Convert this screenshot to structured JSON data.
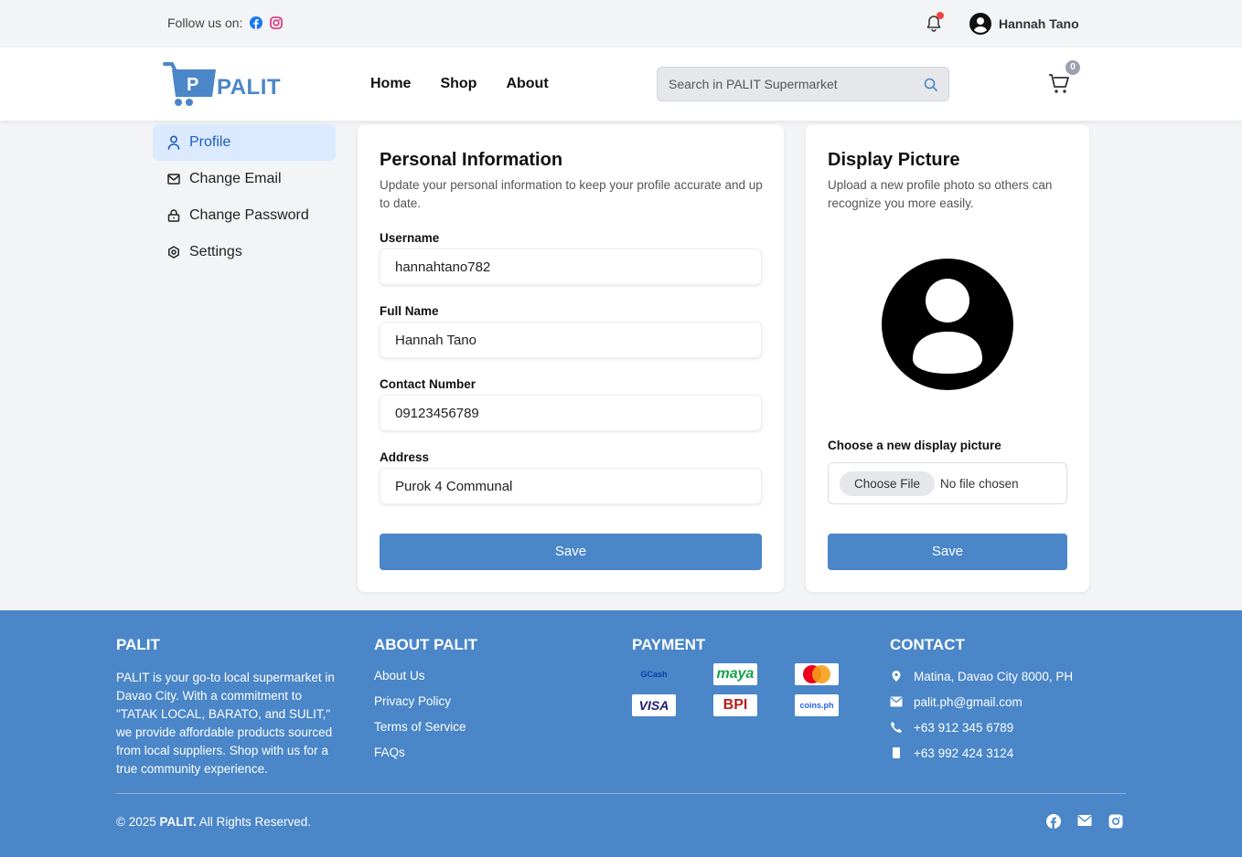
{
  "topbar": {
    "follow_label": "Follow us on:",
    "user_name": "Hannah Tano"
  },
  "header": {
    "logo_text": "PALIT",
    "logo_letter": "P",
    "nav": [
      "Home",
      "Shop",
      "About"
    ],
    "search_placeholder": "Search in PALIT Supermarket",
    "cart_count": "0"
  },
  "sidebar": {
    "items": [
      {
        "label": "Profile",
        "icon": "user-icon",
        "active": true
      },
      {
        "label": "Change Email",
        "icon": "mail-icon",
        "active": false
      },
      {
        "label": "Change Password",
        "icon": "lock-icon",
        "active": false
      },
      {
        "label": "Settings",
        "icon": "gear-icon",
        "active": false
      }
    ]
  },
  "personal": {
    "title": "Personal Information",
    "description": "Update your personal information to keep your profile accurate and up to date.",
    "fields": [
      {
        "label": "Username",
        "value": "hannahtano782"
      },
      {
        "label": "Full Name",
        "value": "Hannah Tano"
      },
      {
        "label": "Contact Number",
        "value": "09123456789"
      },
      {
        "label": "Address",
        "value": "Purok 4 Communal"
      }
    ],
    "save_label": "Save"
  },
  "picture": {
    "title": "Display Picture",
    "description": "Upload a new profile photo so others can recognize you more easily.",
    "choose_label": "Choose a new display picture",
    "file_button": "Choose File",
    "file_status": "No file chosen",
    "save_label": "Save"
  },
  "footer": {
    "palit": {
      "title": "PALIT",
      "text": "PALIT is your go-to local supermarket in Davao City. With a commitment to \"TATAK LOCAL, BARATO, and SULIT,\" we provide affordable products sourced from local suppliers. Shop with us for a true community experience."
    },
    "about": {
      "title": "ABOUT PALIT",
      "links": [
        "About Us",
        "Privacy Policy",
        "Terms of Service",
        "FAQs"
      ]
    },
    "payment": {
      "title": "PAYMENT",
      "methods": [
        "GCash",
        "maya",
        "",
        "VISA",
        "BPI",
        "coins.ph"
      ]
    },
    "contact": {
      "title": "CONTACT",
      "address": "Matina, Davao City 8000, PH",
      "email": "palit.ph@gmail.com",
      "phone": "+63 912 345 6789",
      "mobile": "+63 992 424 3124"
    },
    "copyright_prefix": "© 2025 ",
    "copyright_brand": "PALIT.",
    "copyright_suffix": " All Rights Reserved."
  },
  "colors": {
    "brand": "#4a86c8",
    "active_bg": "#dbeafe",
    "notification": "#ef4444"
  }
}
